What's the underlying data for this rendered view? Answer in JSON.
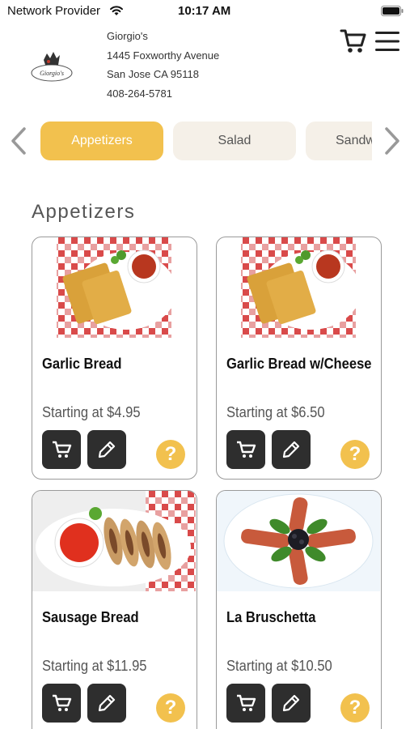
{
  "status_bar": {
    "carrier": "Network Provider",
    "time": "10:17 AM"
  },
  "store": {
    "name": "Giorgio's",
    "address": "1445 Foxworthy Avenue",
    "city": "San Jose CA 95118",
    "phone": "408-264-5781",
    "logo_text": "Giorgio's"
  },
  "categories": [
    {
      "label": "Appetizers",
      "active": true
    },
    {
      "label": "Salad",
      "active": false
    },
    {
      "label": "Sandwiches",
      "active": false
    }
  ],
  "section_title": "Appetizers",
  "items": [
    {
      "name": "Garlic Bread",
      "price": "Starting at $4.95"
    },
    {
      "name": "Garlic Bread w/Cheese",
      "price": "Starting at $6.50"
    },
    {
      "name": "Sausage Bread",
      "price": "Starting at $11.95"
    },
    {
      "name": "La Bruschetta",
      "price": "Starting at $10.50"
    }
  ],
  "help_symbol": "?",
  "colors": {
    "accent": "#f2c14e",
    "button_dark": "#2e2e2e",
    "pill_inactive": "#f5f0e8"
  }
}
